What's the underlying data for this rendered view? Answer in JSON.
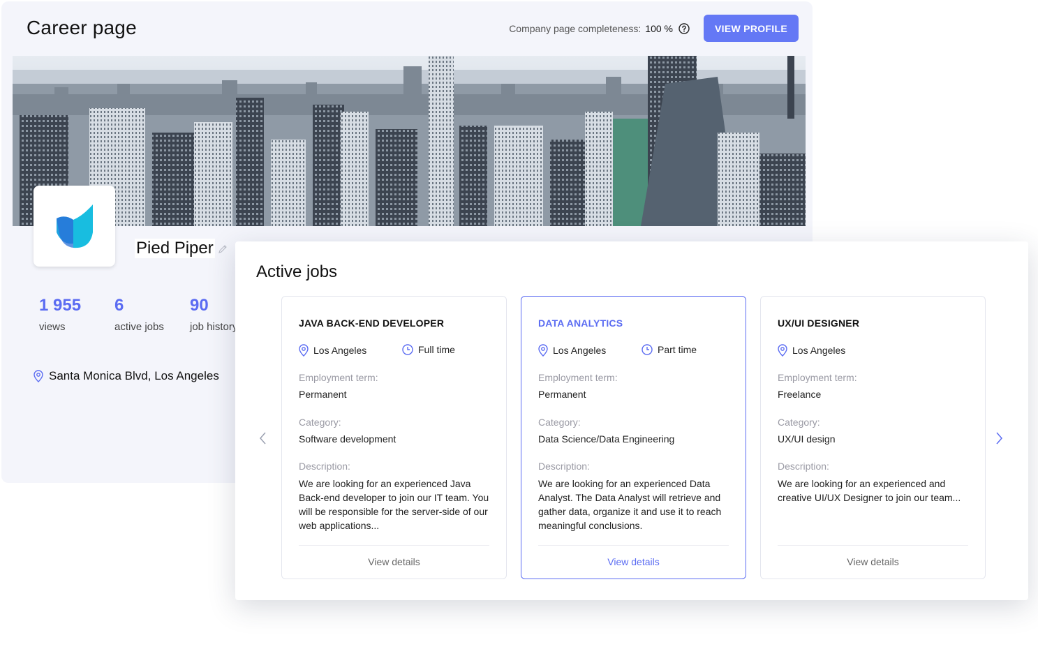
{
  "header": {
    "title": "Career page",
    "completeness_label": "Company page completeness:",
    "completeness_value": "100 %",
    "view_profile_label": "VIEW PROFILE"
  },
  "company": {
    "name": "Pied Piper",
    "address": "Santa Monica Blvd, Los Angeles",
    "stats": [
      {
        "value": "1 955",
        "label": "views"
      },
      {
        "value": "6",
        "label": "active jobs"
      },
      {
        "value": "90",
        "label": "job history"
      }
    ]
  },
  "jobs": {
    "title": "Active jobs",
    "cards": [
      {
        "title": "JAVA BACK-END DEVELOPER",
        "location": "Los Angeles",
        "type": "Full time",
        "term_label": "Employment term:",
        "term": "Permanent",
        "category_label": "Category:",
        "category": "Software development",
        "description_label": "Description:",
        "description": "We are looking for an experienced Java Back-end developer to join our IT team. You will be responsible for the server-side of our web applications...",
        "details_label": "View details"
      },
      {
        "title": "DATA ANALYTICS",
        "location": "Los Angeles",
        "type": "Part time",
        "term_label": "Employment term:",
        "term": "Permanent",
        "category_label": "Category:",
        "category": "Data Science/Data Engineering",
        "description_label": "Description:",
        "description": "We are looking for an experienced Data Analyst. The Data Analyst will retrieve and gather data, organize it and use it to reach meaningful conclusions.",
        "details_label": "View details"
      },
      {
        "title": "UX/UI DESIGNER",
        "location": "Los Angeles",
        "type": "",
        "term_label": "Employment term:",
        "term": "Freelance",
        "category_label": "Category:",
        "category": "UX/UI design",
        "description_label": "Description:",
        "description": "We are looking for an experienced and creative UI/UX Designer to join our team...",
        "details_label": "View details"
      }
    ]
  },
  "colors": {
    "accent": "#5b6cf2",
    "button": "#6478f5",
    "panel_bg": "#f4f5fb"
  },
  "icons": [
    "help-circle-icon",
    "edit-pencil-icon",
    "location-pin-icon",
    "clock-icon",
    "chevron-left-icon",
    "chevron-right-icon",
    "company-logo"
  ]
}
